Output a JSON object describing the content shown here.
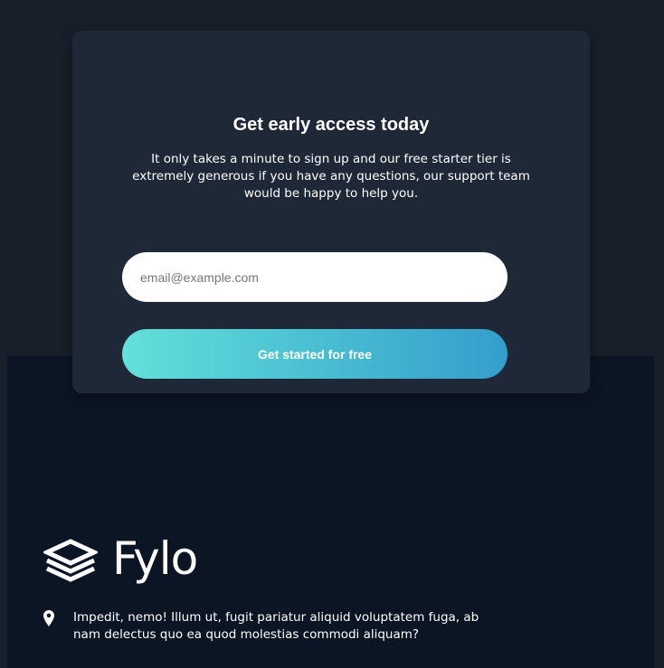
{
  "signup": {
    "title": "Get early access today",
    "description": "It only takes a minute to sign up and our free starter tier is extremely generous if you have any questions, our support team would be happy to help you.",
    "email_placeholder": "email@example.com",
    "email_value": "",
    "cta_label": "Get started for free"
  },
  "footer": {
    "logo_text": "Fylo",
    "logo_icon": "layers-stack-icon",
    "address_icon": "location-pin-icon",
    "address_text": "Impedit, nemo! Illum ut, fugit pariatur aliquid voluptatem fuga, ab nam delectus quo ea quod molestias commodi aliquam?"
  },
  "colors": {
    "page_background": "#181f2a",
    "card_background": "#1f2836",
    "footer_background": "#0c1523",
    "gradient_start": "#62e0d9",
    "gradient_end": "#339ecc",
    "text": "#ffffff"
  }
}
